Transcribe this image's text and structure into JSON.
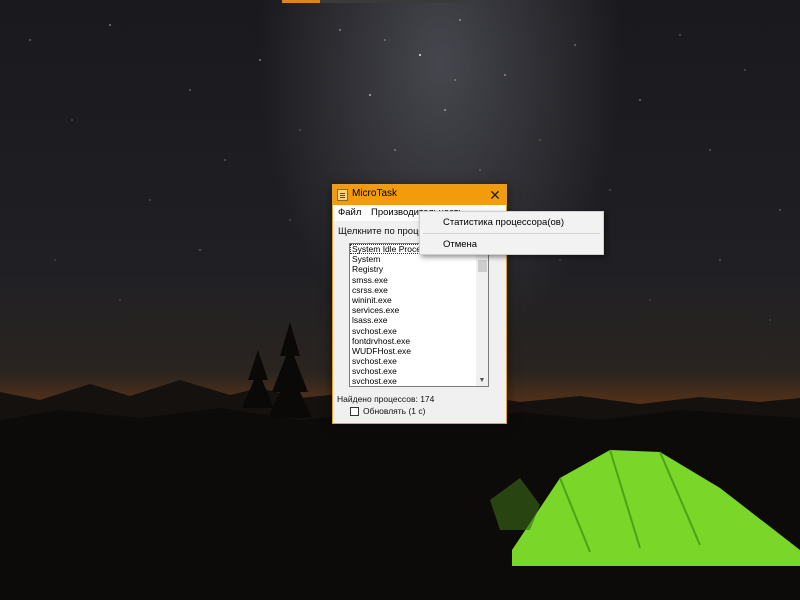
{
  "window": {
    "title": "MicroTask",
    "close_glyph": "✕",
    "icon": "app-icon"
  },
  "menubar": {
    "file": "Файл",
    "performance": "Производительность"
  },
  "hint_text": "Щелкните по процессу",
  "process_list": [
    "System Idle Process",
    "System",
    "Registry",
    "smss.exe",
    "csrss.exe",
    "wininit.exe",
    "services.exe",
    "lsass.exe",
    "svchost.exe",
    "fontdrvhost.exe",
    "WUDFHost.exe",
    "svchost.exe",
    "svchost.exe",
    "svchost.exe"
  ],
  "status": {
    "found_processes": "Найдено процессов: 174",
    "refresh_label": "Обновлять (1 с)",
    "refresh_checked": false
  },
  "dropdown_menu": {
    "items": [
      "Статистика процессора(ов)",
      "Отмена"
    ]
  },
  "colors": {
    "titlebar": "#f29c0d",
    "tent": "#7bd62a"
  }
}
